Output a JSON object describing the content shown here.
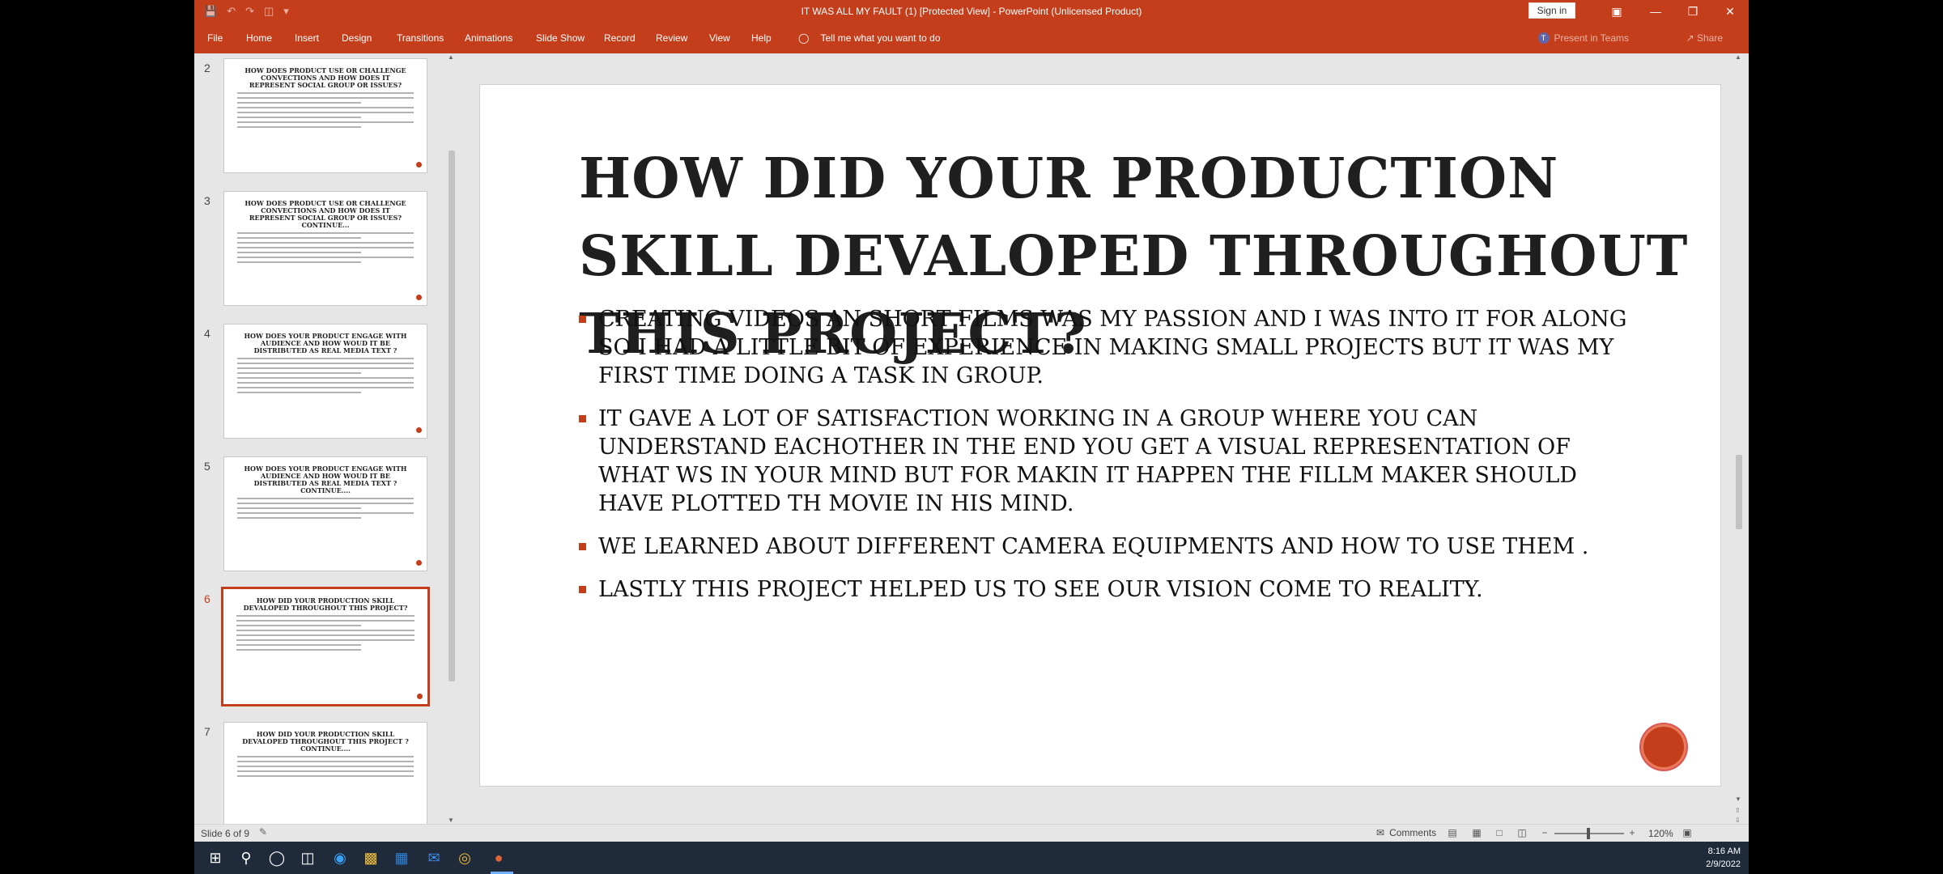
{
  "window": {
    "title": "IT WAS ALL MY FAULT (1) [Protected View]  -  PowerPoint (Unlicensed Product)",
    "sign_in": "Sign in"
  },
  "ribbon": {
    "tabs": [
      "File",
      "Home",
      "Insert",
      "Design",
      "Transitions",
      "Animations",
      "Slide Show",
      "Record",
      "Review",
      "View",
      "Help"
    ],
    "tell_me": "Tell me what you want to do",
    "present_in_teams": "Present in Teams",
    "share": "Share"
  },
  "thumbnails": [
    {
      "number": "2",
      "title": "HOW DOES PRODUCT USE OR CHALLENGE CONVECTIONS AND HOW DOES IT REPRESENT SOCIAL GROUP OR ISSUES?",
      "selected": false
    },
    {
      "number": "3",
      "title": "HOW DOES PRODUCT USE OR CHALLENGE CONVECTIONS AND HOW DOES IT REPRESENT SOCIAL GROUP OR ISSUES? CONTINUE...",
      "selected": false
    },
    {
      "number": "4",
      "title": "HOW DOES YOUR PRODUCT ENGAGE WITH AUDIENCE AND HOW WOUD IT BE DISTRIBUTED AS REAL MEDIA TEXT ?",
      "selected": false
    },
    {
      "number": "5",
      "title": "HOW DOES YOUR PRODUCT ENGAGE WITH AUDIENCE AND HOW WOUD IT BE DISTRIBUTED AS REAL MEDIA TEXT ?CONTINUE....",
      "selected": false
    },
    {
      "number": "6",
      "title": "HOW DID YOUR PRODUCTION SKILL DEVALOPED THROUGHOUT THIS PROJECT?",
      "selected": true
    },
    {
      "number": "7",
      "title": "HOW DID YOUR PRODUCTION SKILL DEVALOPED THROUGHOUT THIS PROJECT ? CONTINUE....",
      "selected": false
    }
  ],
  "slide": {
    "title": "HOW DID YOUR PRODUCTION SKILL DEVALOPED THROUGHOUT THIS PROJECT?",
    "bullets": [
      "CREATING VIDEOS AN SHORT FILMS WAS MY PASSION AND I WAS INTO IT FOR ALONG SO I HAD A LITTLE BIT OF EXPERIENCE IN MAKING SMALL PROJECTS BUT IT WAS MY FIRST TIME DOING A TASK IN GROUP.",
      "IT GAVE A LOT OF SATISFACTION WORKING IN A GROUP WHERE YOU CAN UNDERSTAND EACHOTHER IN THE END YOU GET A VISUAL REPRESENTATION OF WHAT WS IN YOUR MIND BUT FOR MAKIN IT HAPPEN THE FILLM MAKER SHOULD HAVE PLOTTED TH MOVIE IN HIS MIND.",
      "WE LEARNED  ABOUT DIFFERENT CAMERA EQUIPMENTS AND HOW TO USE THEM .",
      "LASTLY THIS PROJECT HELPED US TO SEE OUR VISION COME TO REALITY."
    ],
    "accent_color": "#c43e1c"
  },
  "status": {
    "slide_count": "Slide 6 of 9",
    "comments": "Comments",
    "zoom": "120%"
  },
  "taskbar": {
    "time": "8:16 AM",
    "date": "2/9/2022"
  }
}
